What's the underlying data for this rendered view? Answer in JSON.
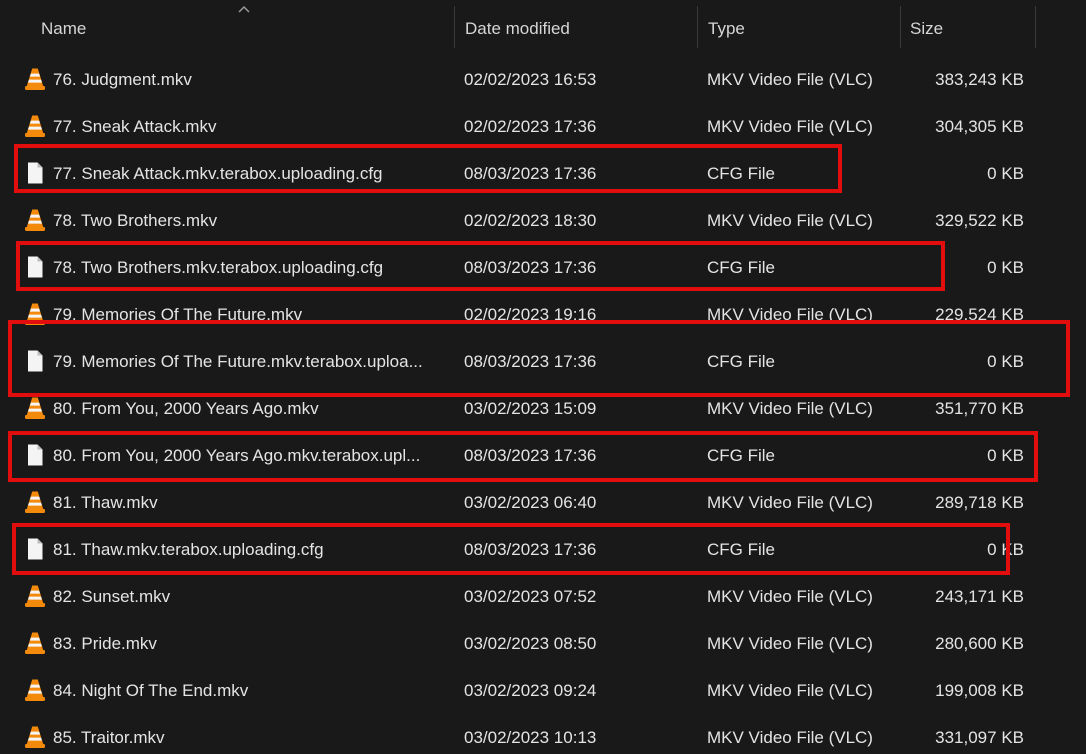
{
  "columns": {
    "name": "Name",
    "date": "Date modified",
    "type": "Type",
    "size": "Size"
  },
  "sort": {
    "column": "name",
    "direction": "ascending"
  },
  "annotation_color": "#e20d0d",
  "files": [
    {
      "icon": "vlc-icon",
      "name": "76. Judgment.mkv",
      "date": "02/02/2023 16:53",
      "type": "MKV Video File (VLC)",
      "size": "383,243 KB",
      "highlighted": false
    },
    {
      "icon": "vlc-icon",
      "name": "77. Sneak Attack.mkv",
      "date": "02/02/2023 17:36",
      "type": "MKV Video File (VLC)",
      "size": "304,305 KB",
      "highlighted": false
    },
    {
      "icon": "file-icon",
      "name": "77. Sneak Attack.mkv.terabox.uploading.cfg",
      "date": "08/03/2023 17:36",
      "type": "CFG File",
      "size": "0 KB",
      "highlighted": true
    },
    {
      "icon": "vlc-icon",
      "name": "78. Two Brothers.mkv",
      "date": "02/02/2023 18:30",
      "type": "MKV Video File (VLC)",
      "size": "329,522 KB",
      "highlighted": false
    },
    {
      "icon": "file-icon",
      "name": "78. Two Brothers.mkv.terabox.uploading.cfg",
      "date": "08/03/2023 17:36",
      "type": "CFG File",
      "size": "0 KB",
      "highlighted": true
    },
    {
      "icon": "vlc-icon",
      "name": "79. Memories Of The Future.mkv",
      "date": "02/02/2023 19:16",
      "type": "MKV Video File (VLC)",
      "size": "229,524 KB",
      "highlighted": false
    },
    {
      "icon": "file-icon",
      "name": "79. Memories Of The Future.mkv.terabox.uploa...",
      "date": "08/03/2023 17:36",
      "type": "CFG File",
      "size": "0 KB",
      "highlighted": true
    },
    {
      "icon": "vlc-icon",
      "name": "80. From You, 2000 Years Ago.mkv",
      "date": "03/02/2023 15:09",
      "type": "MKV Video File (VLC)",
      "size": "351,770 KB",
      "highlighted": false
    },
    {
      "icon": "file-icon",
      "name": "80. From You, 2000 Years Ago.mkv.terabox.upl...",
      "date": "08/03/2023 17:36",
      "type": "CFG File",
      "size": "0 KB",
      "highlighted": true
    },
    {
      "icon": "vlc-icon",
      "name": "81. Thaw.mkv",
      "date": "03/02/2023 06:40",
      "type": "MKV Video File (VLC)",
      "size": "289,718 KB",
      "highlighted": false
    },
    {
      "icon": "file-icon",
      "name": "81. Thaw.mkv.terabox.uploading.cfg",
      "date": "08/03/2023 17:36",
      "type": "CFG File",
      "size": "0 KB",
      "highlighted": true
    },
    {
      "icon": "vlc-icon",
      "name": "82. Sunset.mkv",
      "date": "03/02/2023 07:52",
      "type": "MKV Video File (VLC)",
      "size": "243,171 KB",
      "highlighted": false
    },
    {
      "icon": "vlc-icon",
      "name": "83. Pride.mkv",
      "date": "03/02/2023 08:50",
      "type": "MKV Video File (VLC)",
      "size": "280,600 KB",
      "highlighted": false
    },
    {
      "icon": "vlc-icon",
      "name": "84. Night Of The End.mkv",
      "date": "03/02/2023 09:24",
      "type": "MKV Video File (VLC)",
      "size": "199,008 KB",
      "highlighted": false
    },
    {
      "icon": "vlc-icon",
      "name": "85. Traitor.mkv",
      "date": "03/02/2023 10:13",
      "type": "MKV Video File (VLC)",
      "size": "331,097 KB",
      "highlighted": false
    }
  ]
}
